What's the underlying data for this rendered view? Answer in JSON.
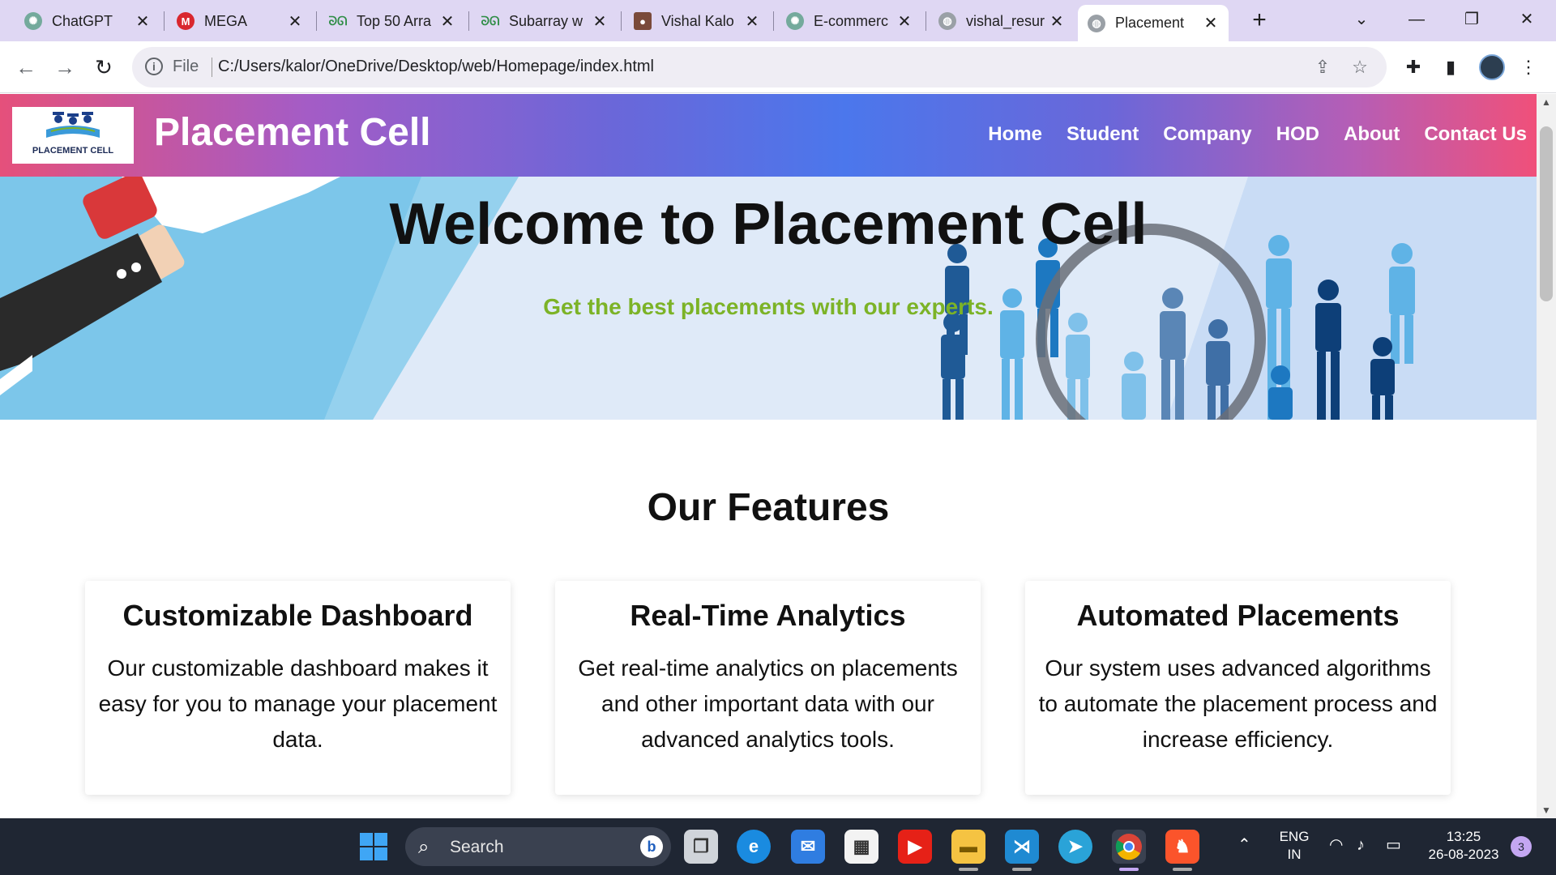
{
  "browser": {
    "tabs": [
      {
        "title": "ChatGPT",
        "icon": "chatgpt-icon"
      },
      {
        "title": "MEGA",
        "icon": "mega-icon"
      },
      {
        "title": "Top 50 Arra",
        "icon": "gfg-icon"
      },
      {
        "title": "Subarray w",
        "icon": "gfg-icon"
      },
      {
        "title": "Vishal Kalo",
        "icon": "profile-icon"
      },
      {
        "title": "E-commerc",
        "icon": "chatgpt-icon"
      },
      {
        "title": "vishal_resur",
        "icon": "globe-icon"
      },
      {
        "title": "Placement",
        "icon": "globe-icon",
        "active": true
      }
    ],
    "address": {
      "scheme": "File",
      "url": "C:/Users/kalor/OneDrive/Desktop/web/Homepage/index.html"
    }
  },
  "site": {
    "logo_text": "PLACEMENT CELL",
    "brand": "Placement Cell",
    "nav": [
      "Home",
      "Student",
      "Company",
      "HOD",
      "About",
      "Contact Us"
    ],
    "hero": {
      "title": "Welcome to Placement Cell",
      "subtitle": "Get the best placements with our experts."
    },
    "features": {
      "title": "Our Features",
      "items": [
        {
          "title": "Customizable Dashboard",
          "text": "Our customizable dashboard makes it easy for you to manage your placement data."
        },
        {
          "title": "Real-Time Analytics",
          "text": "Get real-time analytics on placements and other important data with our advanced analytics tools."
        },
        {
          "title": "Automated Placements",
          "text": "Our system uses advanced algorithms to automate the placement process and increase efficiency."
        }
      ]
    }
  },
  "taskbar": {
    "search_text": "Search",
    "language": "ENG",
    "region": "IN",
    "time": "13:25",
    "date": "26-08-2023",
    "notification_count": "3"
  },
  "colors": {
    "accent_green": "#7cb327",
    "tab_strip": "#dfd7f3",
    "taskbar": "#1f2633"
  }
}
